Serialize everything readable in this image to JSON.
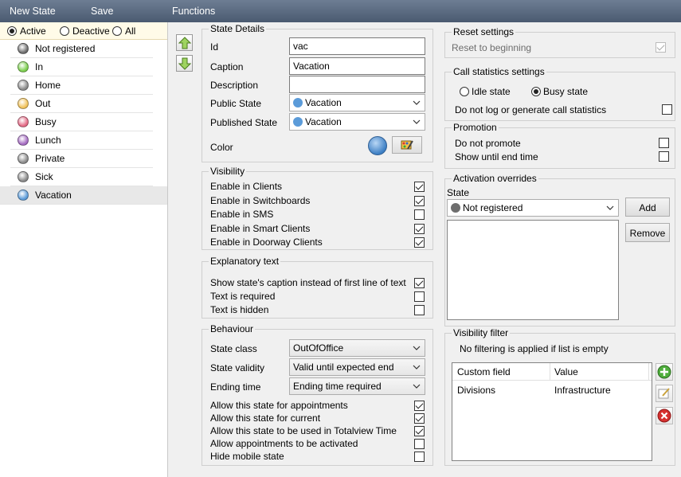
{
  "toolbar": {
    "new_state": "New State",
    "save": "Save",
    "functions": "Functions"
  },
  "filter": {
    "active": "Active",
    "deactive": "Deactive",
    "all": "All",
    "selected": "active"
  },
  "states": [
    {
      "label": "Not registered",
      "color": "#6e6e6e"
    },
    {
      "label": "In",
      "color": "#7ccf4e"
    },
    {
      "label": "Home",
      "color": "#8a8a8a"
    },
    {
      "label": "Out",
      "color": "#f1c25a"
    },
    {
      "label": "Busy",
      "color": "#e46b86"
    },
    {
      "label": "Lunch",
      "color": "#a56cc2"
    },
    {
      "label": "Private",
      "color": "#8a8a8a"
    },
    {
      "label": "Sick",
      "color": "#8a8a8a"
    },
    {
      "label": "Vacation",
      "color": "#5b9bd9",
      "selected": true
    }
  ],
  "state_details": {
    "title": "State Details",
    "id_label": "Id",
    "id_value": "vac",
    "caption_label": "Caption",
    "caption_value": "Vacation",
    "description_label": "Description",
    "description_value": "",
    "public_state_label": "Public State",
    "public_state_value": "Vacation",
    "published_state_label": "Published State",
    "published_state_value": "Vacation",
    "color_label": "Color",
    "color_value": "#5b9bd9"
  },
  "visibility": {
    "title": "Visibility",
    "items": [
      {
        "label": "Enable in Clients",
        "checked": true
      },
      {
        "label": "Enable in Switchboards",
        "checked": true
      },
      {
        "label": "Enable in SMS",
        "checked": false
      },
      {
        "label": "Enable in Smart Clients",
        "checked": true
      },
      {
        "label": "Enable in Doorway Clients",
        "checked": true
      }
    ]
  },
  "explanatory": {
    "title": "Explanatory text",
    "items": [
      {
        "label": "Show state's caption instead of first line of text",
        "checked": true
      },
      {
        "label": "Text is required",
        "checked": false
      },
      {
        "label": "Text is hidden",
        "checked": false
      }
    ]
  },
  "behaviour": {
    "title": "Behaviour",
    "state_class_label": "State class",
    "state_class_value": "OutOfOffice",
    "state_validity_label": "State validity",
    "state_validity_value": "Valid until expected end",
    "ending_time_label": "Ending time",
    "ending_time_value": "Ending time required",
    "items": [
      {
        "label": "Allow this state for appointments",
        "checked": true
      },
      {
        "label": "Allow this state for current",
        "checked": true
      },
      {
        "label": "Allow this state to be used in Totalview Time",
        "checked": true
      },
      {
        "label": "Allow appointments to be activated",
        "checked": false
      },
      {
        "label": "Hide mobile state",
        "checked": false
      }
    ]
  },
  "reset": {
    "title": "Reset settings",
    "label": "Reset to beginning",
    "checked": true
  },
  "call_stats": {
    "title": "Call statistics settings",
    "idle": "Idle state",
    "busy": "Busy state",
    "selected": "busy",
    "no_log_label": "Do not log or generate call statistics",
    "no_log_checked": false
  },
  "promotion": {
    "title": "Promotion",
    "items": [
      {
        "label": "Do not promote",
        "checked": false
      },
      {
        "label": "Show until end time",
        "checked": false
      }
    ]
  },
  "activation": {
    "title": "Activation overrides",
    "state_label": "State",
    "state_value": "Not registered",
    "add": "Add",
    "remove": "Remove"
  },
  "visibility_filter": {
    "title": "Visibility filter",
    "note": "No filtering is applied if list is empty",
    "columns": [
      "Custom field",
      "Value"
    ],
    "rows": [
      {
        "field": "Divisions",
        "value": "Infrastructure"
      }
    ]
  }
}
